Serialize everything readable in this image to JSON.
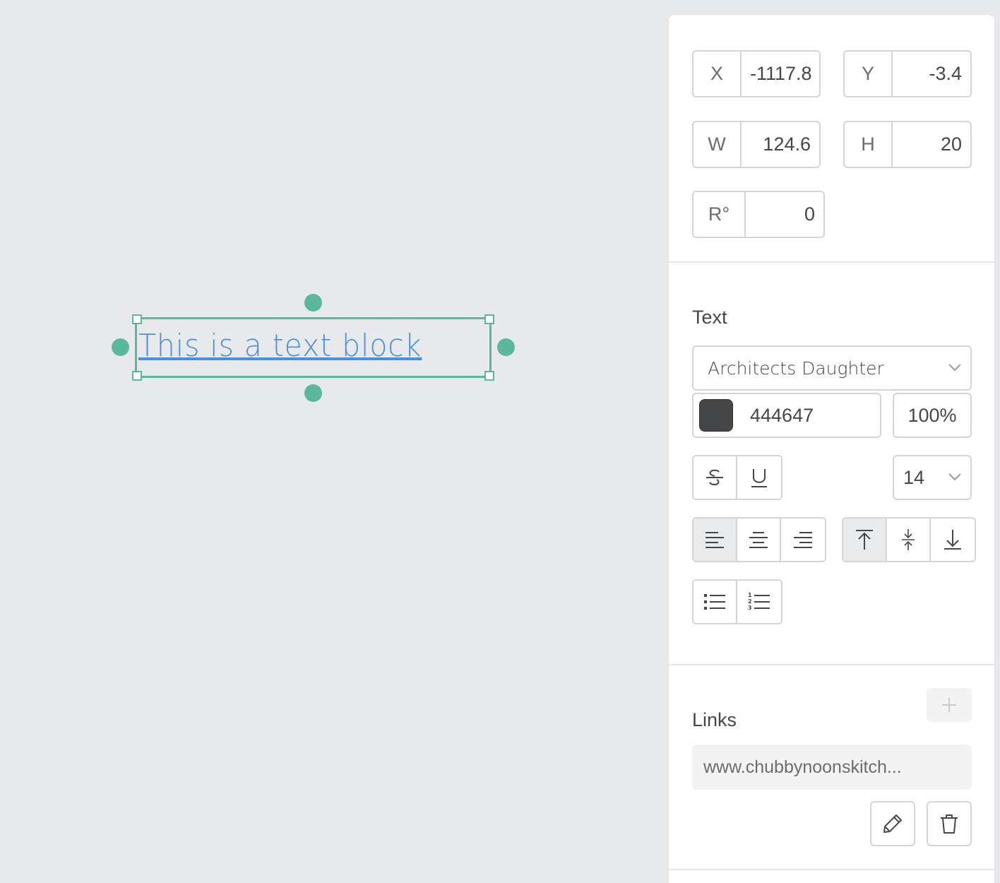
{
  "canvas": {
    "text_block": "This is a text block"
  },
  "geometry": {
    "x": {
      "label": "X",
      "value": "-1117.8"
    },
    "y": {
      "label": "Y",
      "value": "-3.4"
    },
    "w": {
      "label": "W",
      "value": "124.6"
    },
    "h": {
      "label": "H",
      "value": "20"
    },
    "r": {
      "label": "R°",
      "value": "0"
    }
  },
  "text": {
    "title": "Text",
    "font_family": "Architects Daughter",
    "color_hex": "444647",
    "color": "#444647",
    "opacity": "100%",
    "font_size": "14",
    "align_h_selected": "left",
    "align_v_selected": "top"
  },
  "links": {
    "title": "Links",
    "url": "www.chubbynoonskitch..."
  },
  "colors": {
    "selection": "#5bb89c",
    "link_text": "#4a90d9"
  }
}
